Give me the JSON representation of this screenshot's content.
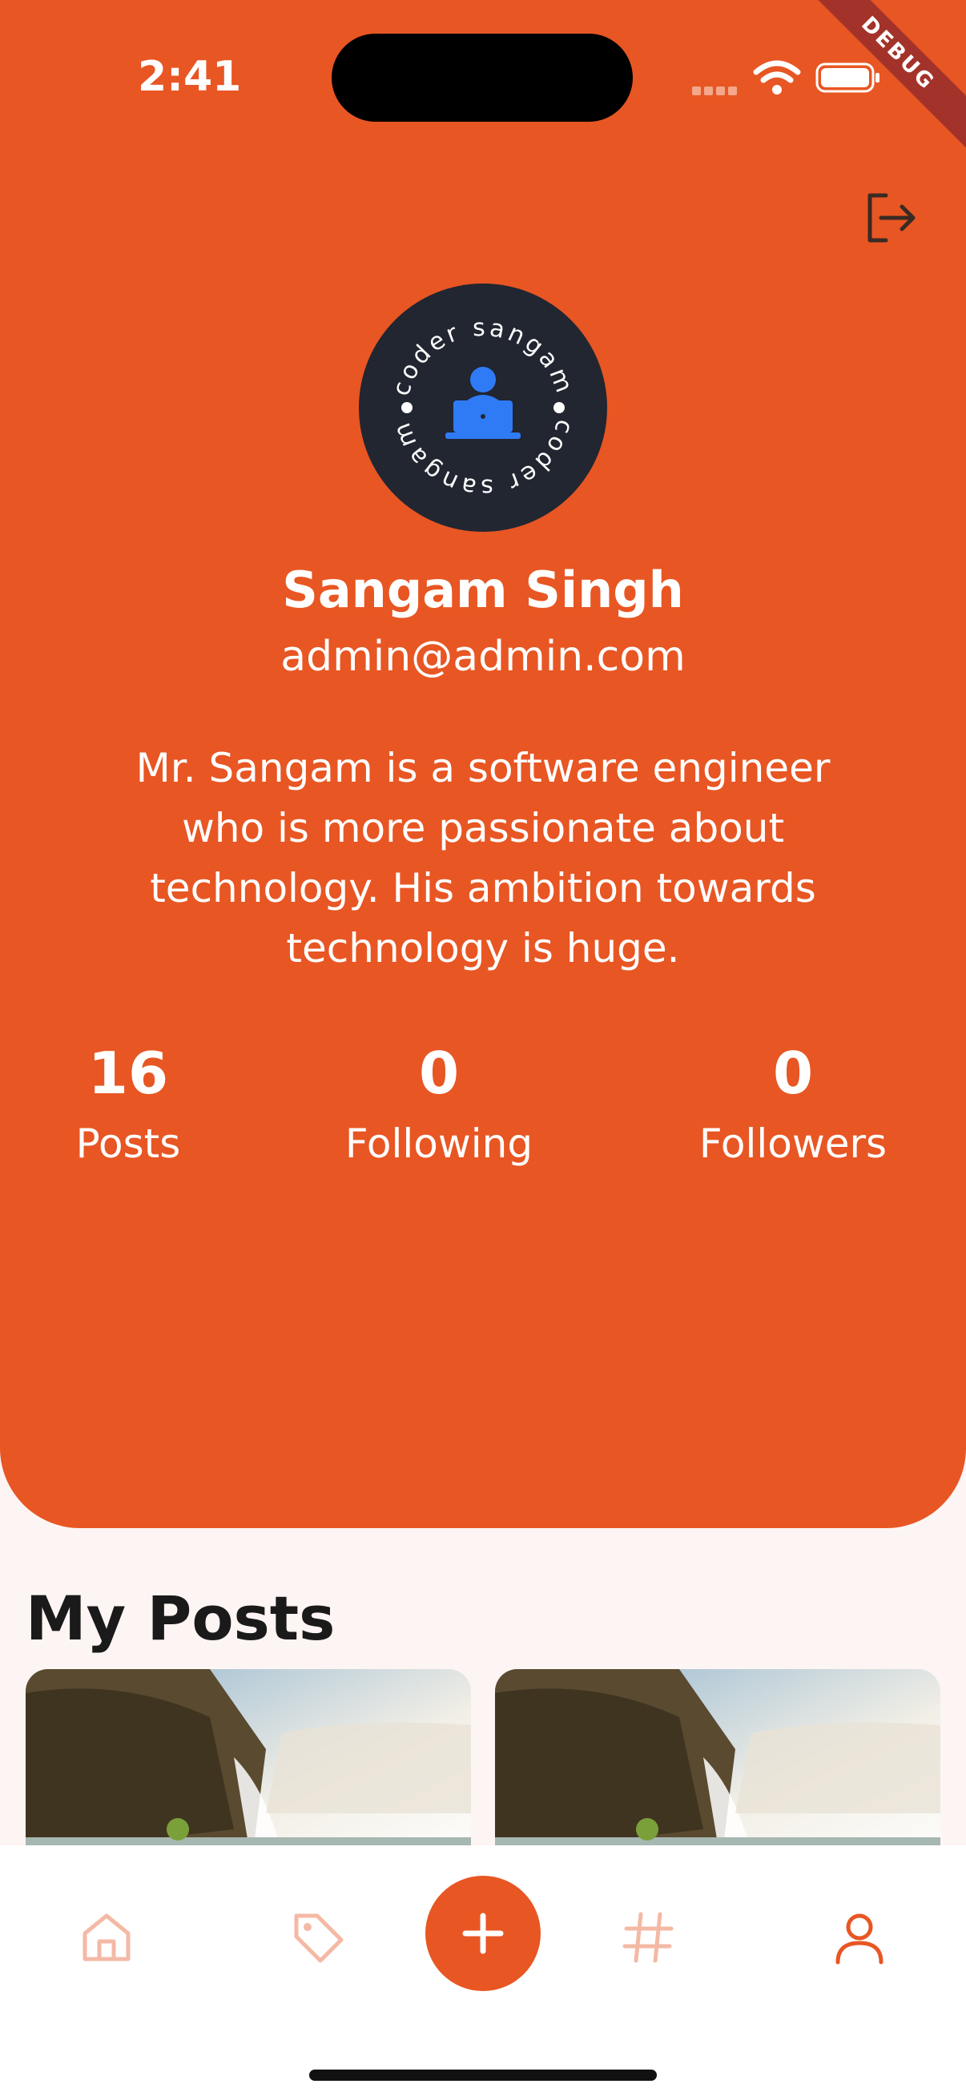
{
  "status_bar": {
    "time": "2:41",
    "debug_label": "DEBUG"
  },
  "profile": {
    "avatar_text": "coder sangam",
    "name": "Sangam Singh",
    "email": "admin@admin.com",
    "bio": "Mr. Sangam is a software engineer who is more passionate about technology. His ambition towards technology is huge."
  },
  "stats": [
    {
      "value": "16",
      "label": "Posts"
    },
    {
      "value": "0",
      "label": "Following"
    },
    {
      "value": "0",
      "label": "Followers"
    }
  ],
  "section": {
    "title": "My Posts"
  },
  "nav": {
    "items": [
      "home-icon",
      "tag-icon",
      "add-icon",
      "hashtag-icon",
      "profile-icon"
    ],
    "active": "profile-icon"
  },
  "colors": {
    "accent": "#e85623",
    "background": "#fdf5f3",
    "avatar_bg": "#212631",
    "icon_inactive": "#f4b9a5"
  }
}
